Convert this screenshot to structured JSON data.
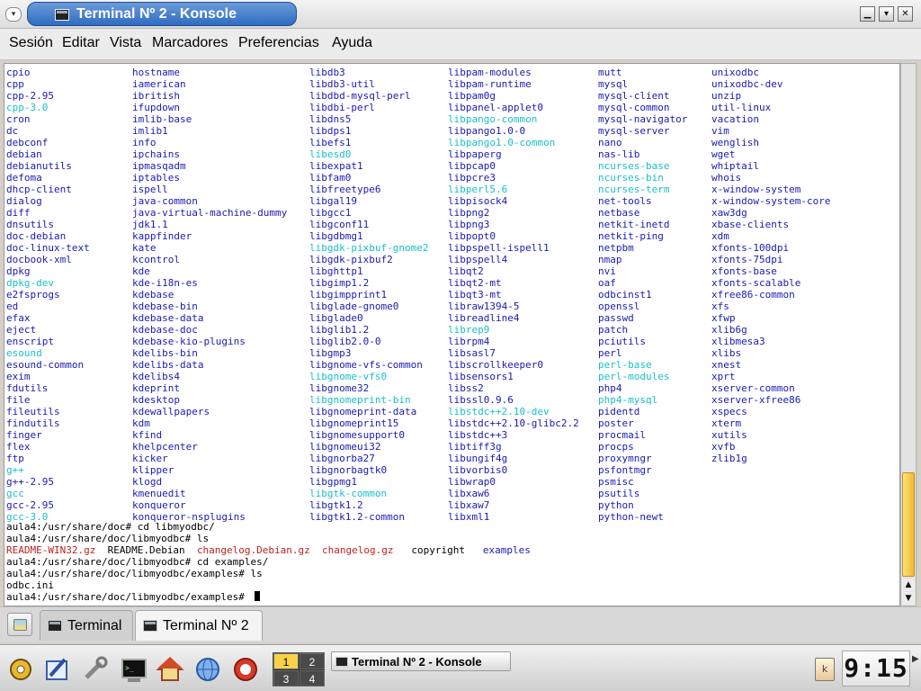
{
  "window": {
    "title": "Terminal Nº 2 - Konsole",
    "icon": "terminal-icon",
    "buttons": {
      "menu": "▾",
      "minimize": "▁",
      "maximize": "▾",
      "close": "✕"
    }
  },
  "menubar": [
    "Sesión",
    "Editar",
    "Vista",
    "Marcadores",
    "Preferencias",
    "Ayuda"
  ],
  "listing": {
    "columns": [
      [
        {
          "t": "cpio",
          "c": "blue"
        },
        {
          "t": "cpp",
          "c": "blue"
        },
        {
          "t": "cpp-2.95",
          "c": "blue"
        },
        {
          "t": "cpp-3.0",
          "c": "cyan"
        },
        {
          "t": "cron",
          "c": "blue"
        },
        {
          "t": "dc",
          "c": "blue"
        },
        {
          "t": "debconf",
          "c": "blue"
        },
        {
          "t": "debian",
          "c": "blue"
        },
        {
          "t": "debianutils",
          "c": "blue"
        },
        {
          "t": "defoma",
          "c": "blue"
        },
        {
          "t": "dhcp-client",
          "c": "blue"
        },
        {
          "t": "dialog",
          "c": "blue"
        },
        {
          "t": "diff",
          "c": "blue"
        },
        {
          "t": "dnsutils",
          "c": "blue"
        },
        {
          "t": "doc-debian",
          "c": "blue"
        },
        {
          "t": "doc-linux-text",
          "c": "blue"
        },
        {
          "t": "docbook-xml",
          "c": "blue"
        },
        {
          "t": "dpkg",
          "c": "blue"
        },
        {
          "t": "dpkg-dev",
          "c": "cyan"
        },
        {
          "t": "e2fsprogs",
          "c": "blue"
        },
        {
          "t": "ed",
          "c": "blue"
        },
        {
          "t": "efax",
          "c": "blue"
        },
        {
          "t": "eject",
          "c": "blue"
        },
        {
          "t": "enscript",
          "c": "blue"
        },
        {
          "t": "esound",
          "c": "cyan"
        },
        {
          "t": "esound-common",
          "c": "blue"
        },
        {
          "t": "exim",
          "c": "blue"
        },
        {
          "t": "fdutils",
          "c": "blue"
        },
        {
          "t": "file",
          "c": "blue"
        },
        {
          "t": "fileutils",
          "c": "blue"
        },
        {
          "t": "findutils",
          "c": "blue"
        },
        {
          "t": "finger",
          "c": "blue"
        },
        {
          "t": "flex",
          "c": "blue"
        },
        {
          "t": "ftp",
          "c": "blue"
        },
        {
          "t": "g++",
          "c": "cyan"
        },
        {
          "t": "g++-2.95",
          "c": "blue"
        },
        {
          "t": "gcc",
          "c": "cyan"
        },
        {
          "t": "gcc-2.95",
          "c": "blue"
        },
        {
          "t": "gcc-3.0",
          "c": "cyan"
        }
      ],
      [
        {
          "t": "hostname",
          "c": "blue"
        },
        {
          "t": "iamerican",
          "c": "blue"
        },
        {
          "t": "ibritish",
          "c": "blue"
        },
        {
          "t": "ifupdown",
          "c": "blue"
        },
        {
          "t": "imlib-base",
          "c": "blue"
        },
        {
          "t": "imlib1",
          "c": "blue"
        },
        {
          "t": "info",
          "c": "blue"
        },
        {
          "t": "ipchains",
          "c": "blue"
        },
        {
          "t": "ipmasqadm",
          "c": "blue"
        },
        {
          "t": "iptables",
          "c": "blue"
        },
        {
          "t": "ispell",
          "c": "blue"
        },
        {
          "t": "java-common",
          "c": "blue"
        },
        {
          "t": "java-virtual-machine-dummy",
          "c": "blue"
        },
        {
          "t": "jdk1.1",
          "c": "blue"
        },
        {
          "t": "kappfinder",
          "c": "blue"
        },
        {
          "t": "kate",
          "c": "blue"
        },
        {
          "t": "kcontrol",
          "c": "blue"
        },
        {
          "t": "kde",
          "c": "blue"
        },
        {
          "t": "kde-i18n-es",
          "c": "blue"
        },
        {
          "t": "kdebase",
          "c": "blue"
        },
        {
          "t": "kdebase-bin",
          "c": "blue"
        },
        {
          "t": "kdebase-data",
          "c": "blue"
        },
        {
          "t": "kdebase-doc",
          "c": "blue"
        },
        {
          "t": "kdebase-kio-plugins",
          "c": "blue"
        },
        {
          "t": "kdelibs-bin",
          "c": "blue"
        },
        {
          "t": "kdelibs-data",
          "c": "blue"
        },
        {
          "t": "kdelibs4",
          "c": "blue"
        },
        {
          "t": "kdeprint",
          "c": "blue"
        },
        {
          "t": "kdesktop",
          "c": "blue"
        },
        {
          "t": "kdewallpapers",
          "c": "blue"
        },
        {
          "t": "kdm",
          "c": "blue"
        },
        {
          "t": "kfind",
          "c": "blue"
        },
        {
          "t": "khelpcenter",
          "c": "blue"
        },
        {
          "t": "kicker",
          "c": "blue"
        },
        {
          "t": "klipper",
          "c": "blue"
        },
        {
          "t": "klogd",
          "c": "blue"
        },
        {
          "t": "kmenuedit",
          "c": "blue"
        },
        {
          "t": "konqueror",
          "c": "blue"
        },
        {
          "t": "konqueror-nsplugins",
          "c": "blue"
        }
      ],
      [
        {
          "t": "libdb3",
          "c": "blue"
        },
        {
          "t": "libdb3-util",
          "c": "blue"
        },
        {
          "t": "libdbd-mysql-perl",
          "c": "blue"
        },
        {
          "t": "libdbi-perl",
          "c": "blue"
        },
        {
          "t": "libdns5",
          "c": "blue"
        },
        {
          "t": "libdps1",
          "c": "blue"
        },
        {
          "t": "libefs1",
          "c": "blue"
        },
        {
          "t": "libesd0",
          "c": "cyan"
        },
        {
          "t": "libexpat1",
          "c": "blue"
        },
        {
          "t": "libfam0",
          "c": "blue"
        },
        {
          "t": "libfreetype6",
          "c": "blue"
        },
        {
          "t": "libgal19",
          "c": "blue"
        },
        {
          "t": "libgcc1",
          "c": "blue"
        },
        {
          "t": "libgconf11",
          "c": "blue"
        },
        {
          "t": "libgdbmg1",
          "c": "blue"
        },
        {
          "t": "libgdk-pixbuf-gnome2",
          "c": "cyan"
        },
        {
          "t": "libgdk-pixbuf2",
          "c": "blue"
        },
        {
          "t": "libghttp1",
          "c": "blue"
        },
        {
          "t": "libgimp1.2",
          "c": "blue"
        },
        {
          "t": "libgimpprint1",
          "c": "blue"
        },
        {
          "t": "libglade-gnome0",
          "c": "blue"
        },
        {
          "t": "libglade0",
          "c": "blue"
        },
        {
          "t": "libglib1.2",
          "c": "blue"
        },
        {
          "t": "libglib2.0-0",
          "c": "blue"
        },
        {
          "t": "libgmp3",
          "c": "blue"
        },
        {
          "t": "libgnome-vfs-common",
          "c": "blue"
        },
        {
          "t": "libgnome-vfs0",
          "c": "cyan"
        },
        {
          "t": "libgnome32",
          "c": "blue"
        },
        {
          "t": "libgnomeprint-bin",
          "c": "cyan"
        },
        {
          "t": "libgnomeprint-data",
          "c": "blue"
        },
        {
          "t": "libgnomeprint15",
          "c": "blue"
        },
        {
          "t": "libgnomesupport0",
          "c": "blue"
        },
        {
          "t": "libgnomeui32",
          "c": "blue"
        },
        {
          "t": "libgnorba27",
          "c": "blue"
        },
        {
          "t": "libgnorbagtk0",
          "c": "blue"
        },
        {
          "t": "libgpmg1",
          "c": "blue"
        },
        {
          "t": "libgtk-common",
          "c": "cyan"
        },
        {
          "t": "libgtk1.2",
          "c": "blue"
        },
        {
          "t": "libgtk1.2-common",
          "c": "blue"
        }
      ],
      [
        {
          "t": "libpam-modules",
          "c": "blue"
        },
        {
          "t": "libpam-runtime",
          "c": "blue"
        },
        {
          "t": "libpam0g",
          "c": "blue"
        },
        {
          "t": "libpanel-applet0",
          "c": "blue"
        },
        {
          "t": "libpango-common",
          "c": "cyan"
        },
        {
          "t": "libpango1.0-0",
          "c": "blue"
        },
        {
          "t": "libpango1.0-common",
          "c": "cyan"
        },
        {
          "t": "libpaperg",
          "c": "blue"
        },
        {
          "t": "libpcap0",
          "c": "blue"
        },
        {
          "t": "libpcre3",
          "c": "blue"
        },
        {
          "t": "libperl5.6",
          "c": "cyan"
        },
        {
          "t": "libpisock4",
          "c": "blue"
        },
        {
          "t": "libpng2",
          "c": "blue"
        },
        {
          "t": "libpng3",
          "c": "blue"
        },
        {
          "t": "libpopt0",
          "c": "blue"
        },
        {
          "t": "libpspell-ispell1",
          "c": "blue"
        },
        {
          "t": "libpspell4",
          "c": "blue"
        },
        {
          "t": "libqt2",
          "c": "blue"
        },
        {
          "t": "libqt2-mt",
          "c": "blue"
        },
        {
          "t": "libqt3-mt",
          "c": "blue"
        },
        {
          "t": "libraw1394-5",
          "c": "blue"
        },
        {
          "t": "libreadline4",
          "c": "blue"
        },
        {
          "t": "librep9",
          "c": "cyan"
        },
        {
          "t": "librpm4",
          "c": "blue"
        },
        {
          "t": "libsasl7",
          "c": "blue"
        },
        {
          "t": "libscrollkeeper0",
          "c": "blue"
        },
        {
          "t": "libsensors1",
          "c": "blue"
        },
        {
          "t": "libss2",
          "c": "blue"
        },
        {
          "t": "libssl0.9.6",
          "c": "blue"
        },
        {
          "t": "libstdc++2.10-dev",
          "c": "cyan"
        },
        {
          "t": "libstdc++2.10-glibc2.2",
          "c": "blue"
        },
        {
          "t": "libstdc++3",
          "c": "blue"
        },
        {
          "t": "libtiff3g",
          "c": "blue"
        },
        {
          "t": "libungif4g",
          "c": "blue"
        },
        {
          "t": "libvorbis0",
          "c": "blue"
        },
        {
          "t": "libwrap0",
          "c": "blue"
        },
        {
          "t": "libxaw6",
          "c": "blue"
        },
        {
          "t": "libxaw7",
          "c": "blue"
        },
        {
          "t": "libxml1",
          "c": "blue"
        }
      ],
      [
        {
          "t": "mutt",
          "c": "blue"
        },
        {
          "t": "mysql",
          "c": "blue"
        },
        {
          "t": "mysql-client",
          "c": "blue"
        },
        {
          "t": "mysql-common",
          "c": "blue"
        },
        {
          "t": "mysql-navigator",
          "c": "blue"
        },
        {
          "t": "mysql-server",
          "c": "blue"
        },
        {
          "t": "nano",
          "c": "blue"
        },
        {
          "t": "nas-lib",
          "c": "blue"
        },
        {
          "t": "ncurses-base",
          "c": "cyan"
        },
        {
          "t": "ncurses-bin",
          "c": "cyan"
        },
        {
          "t": "ncurses-term",
          "c": "cyan"
        },
        {
          "t": "net-tools",
          "c": "blue"
        },
        {
          "t": "netbase",
          "c": "blue"
        },
        {
          "t": "netkit-inetd",
          "c": "blue"
        },
        {
          "t": "netkit-ping",
          "c": "blue"
        },
        {
          "t": "netpbm",
          "c": "blue"
        },
        {
          "t": "nmap",
          "c": "blue"
        },
        {
          "t": "nvi",
          "c": "blue"
        },
        {
          "t": "oaf",
          "c": "blue"
        },
        {
          "t": "odbcinst1",
          "c": "blue"
        },
        {
          "t": "openssl",
          "c": "blue"
        },
        {
          "t": "passwd",
          "c": "blue"
        },
        {
          "t": "patch",
          "c": "blue"
        },
        {
          "t": "pciutils",
          "c": "blue"
        },
        {
          "t": "perl",
          "c": "blue"
        },
        {
          "t": "perl-base",
          "c": "cyan"
        },
        {
          "t": "perl-modules",
          "c": "cyan"
        },
        {
          "t": "php4",
          "c": "blue"
        },
        {
          "t": "php4-mysql",
          "c": "cyan"
        },
        {
          "t": "pidentd",
          "c": "blue"
        },
        {
          "t": "poster",
          "c": "blue"
        },
        {
          "t": "procmail",
          "c": "blue"
        },
        {
          "t": "procps",
          "c": "blue"
        },
        {
          "t": "proxymngr",
          "c": "blue"
        },
        {
          "t": "psfontmgr",
          "c": "blue"
        },
        {
          "t": "psmisc",
          "c": "blue"
        },
        {
          "t": "psutils",
          "c": "blue"
        },
        {
          "t": "python",
          "c": "blue"
        },
        {
          "t": "python-newt",
          "c": "blue"
        }
      ],
      [
        {
          "t": "unixodbc",
          "c": "blue"
        },
        {
          "t": "unixodbc-dev",
          "c": "blue"
        },
        {
          "t": "unzip",
          "c": "blue"
        },
        {
          "t": "util-linux",
          "c": "blue"
        },
        {
          "t": "vacation",
          "c": "blue"
        },
        {
          "t": "vim",
          "c": "blue"
        },
        {
          "t": "wenglish",
          "c": "blue"
        },
        {
          "t": "wget",
          "c": "blue"
        },
        {
          "t": "whiptail",
          "c": "blue"
        },
        {
          "t": "whois",
          "c": "blue"
        },
        {
          "t": "x-window-system",
          "c": "blue"
        },
        {
          "t": "x-window-system-core",
          "c": "blue"
        },
        {
          "t": "xaw3dg",
          "c": "blue"
        },
        {
          "t": "xbase-clients",
          "c": "blue"
        },
        {
          "t": "xdm",
          "c": "blue"
        },
        {
          "t": "xfonts-100dpi",
          "c": "blue"
        },
        {
          "t": "xfonts-75dpi",
          "c": "blue"
        },
        {
          "t": "xfonts-base",
          "c": "blue"
        },
        {
          "t": "xfonts-scalable",
          "c": "blue"
        },
        {
          "t": "xfree86-common",
          "c": "blue"
        },
        {
          "t": "xfs",
          "c": "blue"
        },
        {
          "t": "xfwp",
          "c": "blue"
        },
        {
          "t": "xlib6g",
          "c": "blue"
        },
        {
          "t": "xlibmesa3",
          "c": "blue"
        },
        {
          "t": "xlibs",
          "c": "blue"
        },
        {
          "t": "xnest",
          "c": "blue"
        },
        {
          "t": "xprt",
          "c": "blue"
        },
        {
          "t": "xserver-common",
          "c": "blue"
        },
        {
          "t": "xserver-xfree86",
          "c": "blue"
        },
        {
          "t": "xspecs",
          "c": "blue"
        },
        {
          "t": "xterm",
          "c": "blue"
        },
        {
          "t": "xutils",
          "c": "blue"
        },
        {
          "t": "xvfb",
          "c": "blue"
        },
        {
          "t": "zlib1g",
          "c": "blue"
        }
      ]
    ]
  },
  "session": [
    [
      {
        "t": "aula4:/usr/share/doc# cd libmyodbc/",
        "c": "black"
      }
    ],
    [
      {
        "t": "aula4:/usr/share/doc/libmyodbc# ls",
        "c": "black"
      }
    ],
    [
      {
        "t": "README-WIN32.gz",
        "c": "red"
      },
      {
        "t": "  README.Debian  ",
        "c": "black"
      },
      {
        "t": "changelog.Debian.gz",
        "c": "red"
      },
      {
        "t": "  ",
        "c": "black"
      },
      {
        "t": "changelog.gz",
        "c": "red"
      },
      {
        "t": "   copyright   ",
        "c": "black"
      },
      {
        "t": "examples",
        "c": "blue"
      }
    ],
    [
      {
        "t": "aula4:/usr/share/doc/libmyodbc# cd examples/",
        "c": "black"
      }
    ],
    [
      {
        "t": "aula4:/usr/share/doc/libmyodbc/examples# ls",
        "c": "black"
      }
    ],
    [
      {
        "t": "odbc.ini",
        "c": "black"
      }
    ],
    [
      {
        "t": "aula4:/usr/share/doc/libmyodbc/examples# ",
        "c": "black"
      }
    ]
  ],
  "tabs": [
    {
      "label": "Terminal",
      "active": false
    },
    {
      "label": "Terminal Nº 2",
      "active": true
    }
  ],
  "panel": {
    "launchers": [
      "kde-menu-icon",
      "kwrite-icon",
      "kcontrol-icon",
      "konsole-icon",
      "home-icon",
      "konqueror-icon",
      "help-icon"
    ],
    "pager": [
      "1",
      "2",
      "3",
      "4"
    ],
    "task_label": "Terminal Nº 2 - Konsole",
    "clock": "9:15"
  },
  "colors": {
    "blue": "#1a1ab4",
    "cyan": "#19c0c8",
    "red": "#c02020",
    "black": "#000000"
  }
}
